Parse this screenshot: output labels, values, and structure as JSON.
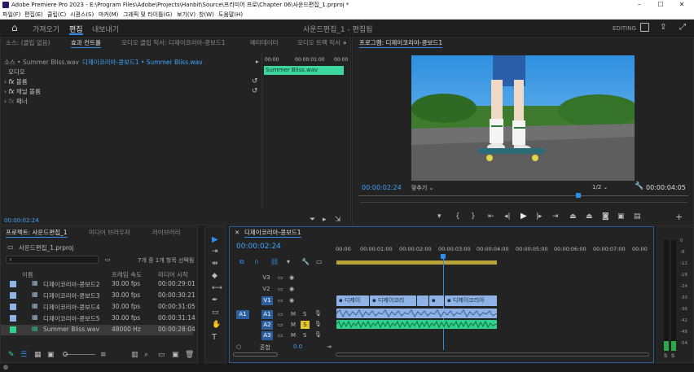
{
  "titlebar": {
    "title": "Adobe Premiere Pro 2023 - E:\\Program Files\\Adobe\\Projects\\Hanbit\\Source\\프리미어 프로\\Chapter 06\\사운드편집_1.prproj *",
    "minimize": "–",
    "maximize": "☐",
    "close": "✕"
  },
  "menu": [
    "파일(F)",
    "편집(E)",
    "클립(C)",
    "시퀀스(S)",
    "마커(M)",
    "그래픽 및 타이틀(G)",
    "보기(V)",
    "창(W)",
    "도움말(H)"
  ],
  "header": {
    "home_icon": "home-icon",
    "workspaces": [
      "가져오기",
      "편집",
      "내보내기"
    ],
    "active_workspace": "편집",
    "project_title": "사운드편집_1 - 편집됨",
    "mode": "EDITING"
  },
  "source_panel": {
    "tabs": [
      "소스: (클립 없음)",
      "효과 컨트롤",
      "오디오 클립 믹서: 디제이코리아-콩보드1",
      "메타데이터",
      "오디오 트랙 믹서"
    ],
    "active_tab": "효과 컨트롤",
    "source_label": "소스 • Summer Bliss.wav",
    "sequence_label": "디제이코리아-콩보드1 • Summer Bliss.wav",
    "section": "오디오",
    "effects": [
      "볼륨",
      "채널 볼륨",
      "패너"
    ],
    "ruler": [
      "00:00",
      "00:00:01:00",
      "00:00"
    ],
    "clip_name": "Summer Bliss.wav",
    "timecode": "00:00:02:24"
  },
  "program": {
    "tab_label": "프로그램: 디제이코리아-콩보드1",
    "timecode": "00:00:02:24",
    "fit": "맞추기",
    "resolution": "1/2",
    "duration": "00:00:04:05"
  },
  "project": {
    "tabs": [
      "프로젝트: 사운드편집_1",
      "미디어 브라우저",
      "라이브러리"
    ],
    "active_tab": "프로젝트: 사운드편집_1",
    "file": "사운드편집_1.prproj",
    "selection": "7개 중 1개 항목 선택됨",
    "columns": [
      "이름",
      "프레임 속도",
      "미디어 시작"
    ],
    "items": [
      {
        "name": "디제이코리아-콩보드2",
        "fps": "30.00 fps",
        "start": "00:00:29:01",
        "color": "#8fb3e6"
      },
      {
        "name": "디제이코리아-콩보드3",
        "fps": "30.00 fps",
        "start": "00:00:30:21",
        "color": "#8fb3e6"
      },
      {
        "name": "디제이코리아-콩보드4",
        "fps": "30.00 fps",
        "start": "00:00:31:05",
        "color": "#8fb3e6"
      },
      {
        "name": "디제이코리아-콩보드5",
        "fps": "30.00 fps",
        "start": "00:00:31:14",
        "color": "#8fb3e6"
      },
      {
        "name": "Summer Bliss.wav",
        "fps": "48000 Hz",
        "start": "00:00:28:04",
        "color": "#2ed18c"
      }
    ]
  },
  "timeline": {
    "tab_label": "디제이코리아-콩보드1",
    "timecode": "00:00:02:24",
    "ruler": [
      "00:00",
      "00:00:01:00",
      "00:00:02:00",
      "00:00:03:00",
      "00:00:04:00",
      "00:00:05:00",
      "00:00:06:00",
      "00:00:07:00",
      "00:00"
    ],
    "video_tracks": [
      "V3",
      "V2",
      "V1"
    ],
    "audio_tracks": [
      "A1",
      "A2",
      "A3"
    ],
    "source_patch_v": "V1",
    "source_patch_a": "A1",
    "clip_labels": [
      "디제이",
      "디제이코리",
      "디제이코리아"
    ],
    "mix_label": "혼합",
    "mix_value": "0.0"
  },
  "meter": {
    "scale": [
      "0",
      "-6",
      "-12",
      "-18",
      "-24",
      "-30",
      "-36",
      "-42",
      "-48",
      "-54"
    ],
    "solo": [
      "S",
      "S"
    ]
  }
}
